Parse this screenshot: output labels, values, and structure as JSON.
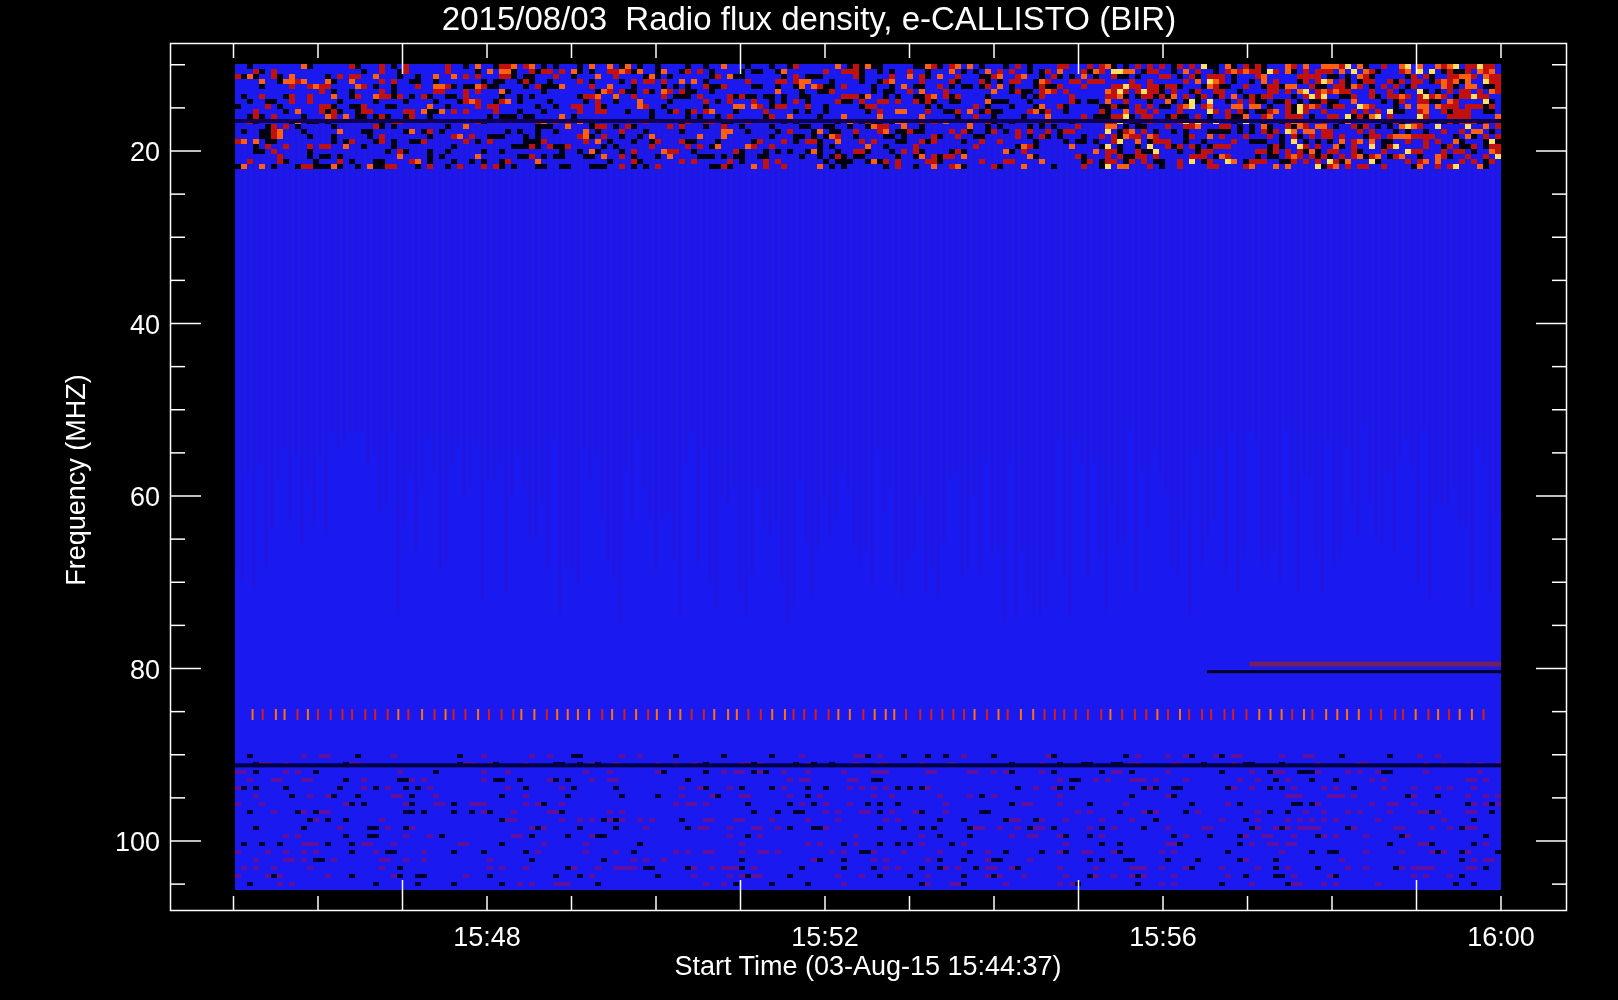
{
  "title": "2015/08/03  Radio flux density, e-CALLISTO (BIR)",
  "y_axis": {
    "label": "Frequency (MHZ)",
    "ticks": [
      "20",
      "40",
      "60",
      "80",
      "100"
    ]
  },
  "x_axis": {
    "label": "Start Time (03-Aug-15 15:44:37)",
    "ticks": [
      "15:48",
      "15:52",
      "15:56",
      "16:00"
    ]
  }
}
